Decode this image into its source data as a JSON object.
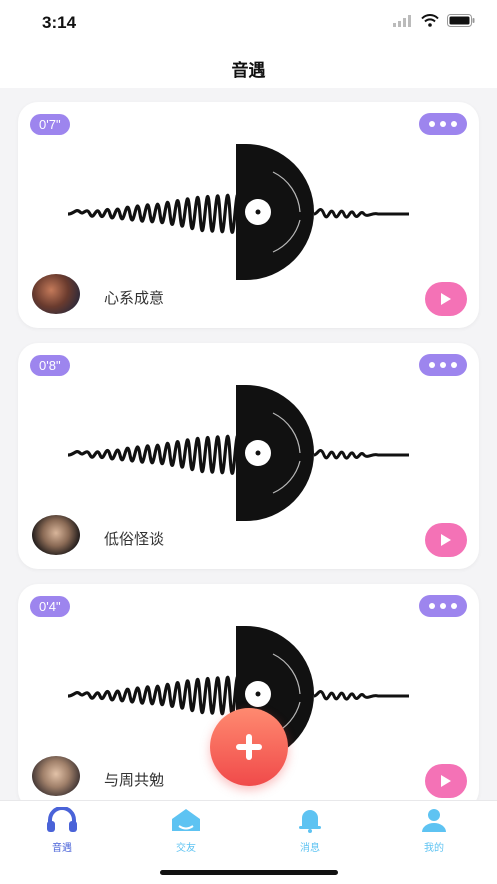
{
  "status_bar": {
    "time": "3:14"
  },
  "header": {
    "title": "音遇"
  },
  "colors": {
    "accent_purple": "#9d85ee",
    "play_pink": "#f472b6",
    "fab_red": "#f04a4a",
    "tab_active": "#4a63d8",
    "tab_inactive": "#5ec3f2"
  },
  "cards": [
    {
      "duration": "0'7\"",
      "username": "心系成意"
    },
    {
      "duration": "0'8\"",
      "username": "低俗怪谈"
    },
    {
      "duration": "0'4\"",
      "username": "与周共勉"
    }
  ],
  "icons": {
    "more": "more-dots-icon",
    "play": "play-icon",
    "fab": "plus-icon"
  },
  "tabs": [
    {
      "label": "音遇",
      "icon": "headphones-icon",
      "active": true
    },
    {
      "label": "交友",
      "icon": "house-icon",
      "active": false
    },
    {
      "label": "消息",
      "icon": "bell-icon",
      "active": false
    },
    {
      "label": "我的",
      "icon": "user-icon",
      "active": false
    }
  ]
}
